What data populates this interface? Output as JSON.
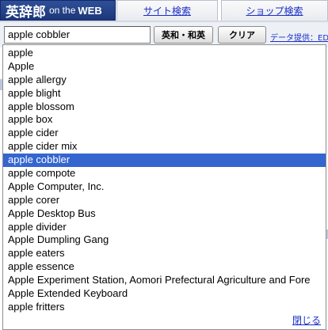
{
  "header": {
    "logo_jp": "英辞郎",
    "logo_en1": "on the",
    "logo_en2": "WEB",
    "tabs": [
      {
        "label": "サイト検索"
      },
      {
        "label": "ショップ検索"
      }
    ]
  },
  "search": {
    "value": "apple cobbler",
    "dict_button": "英和・和英",
    "clear_button": "クリア",
    "provider_link": "データ提供：ED"
  },
  "suggestions": {
    "items": [
      "apple",
      "Apple",
      "apple allergy",
      "apple blight",
      "apple blossom",
      "apple box",
      "apple cider",
      "apple cider mix",
      "apple cobbler",
      "apple compote",
      "Apple Computer, Inc.",
      "apple corer",
      "Apple Desktop Bus",
      "apple divider",
      "Apple Dumpling Gang",
      "apple eaters",
      "apple essence",
      "Apple Experiment Station, Aomori Prefectural Agriculture and Fore",
      "Apple Extended Keyboard",
      "apple fritters"
    ],
    "selected": "apple cobbler",
    "close_label": "閉じる"
  },
  "colors": {
    "selection": "#3565cf",
    "link": "#1a2ec8",
    "logo_bg": "#2e4f98"
  }
}
